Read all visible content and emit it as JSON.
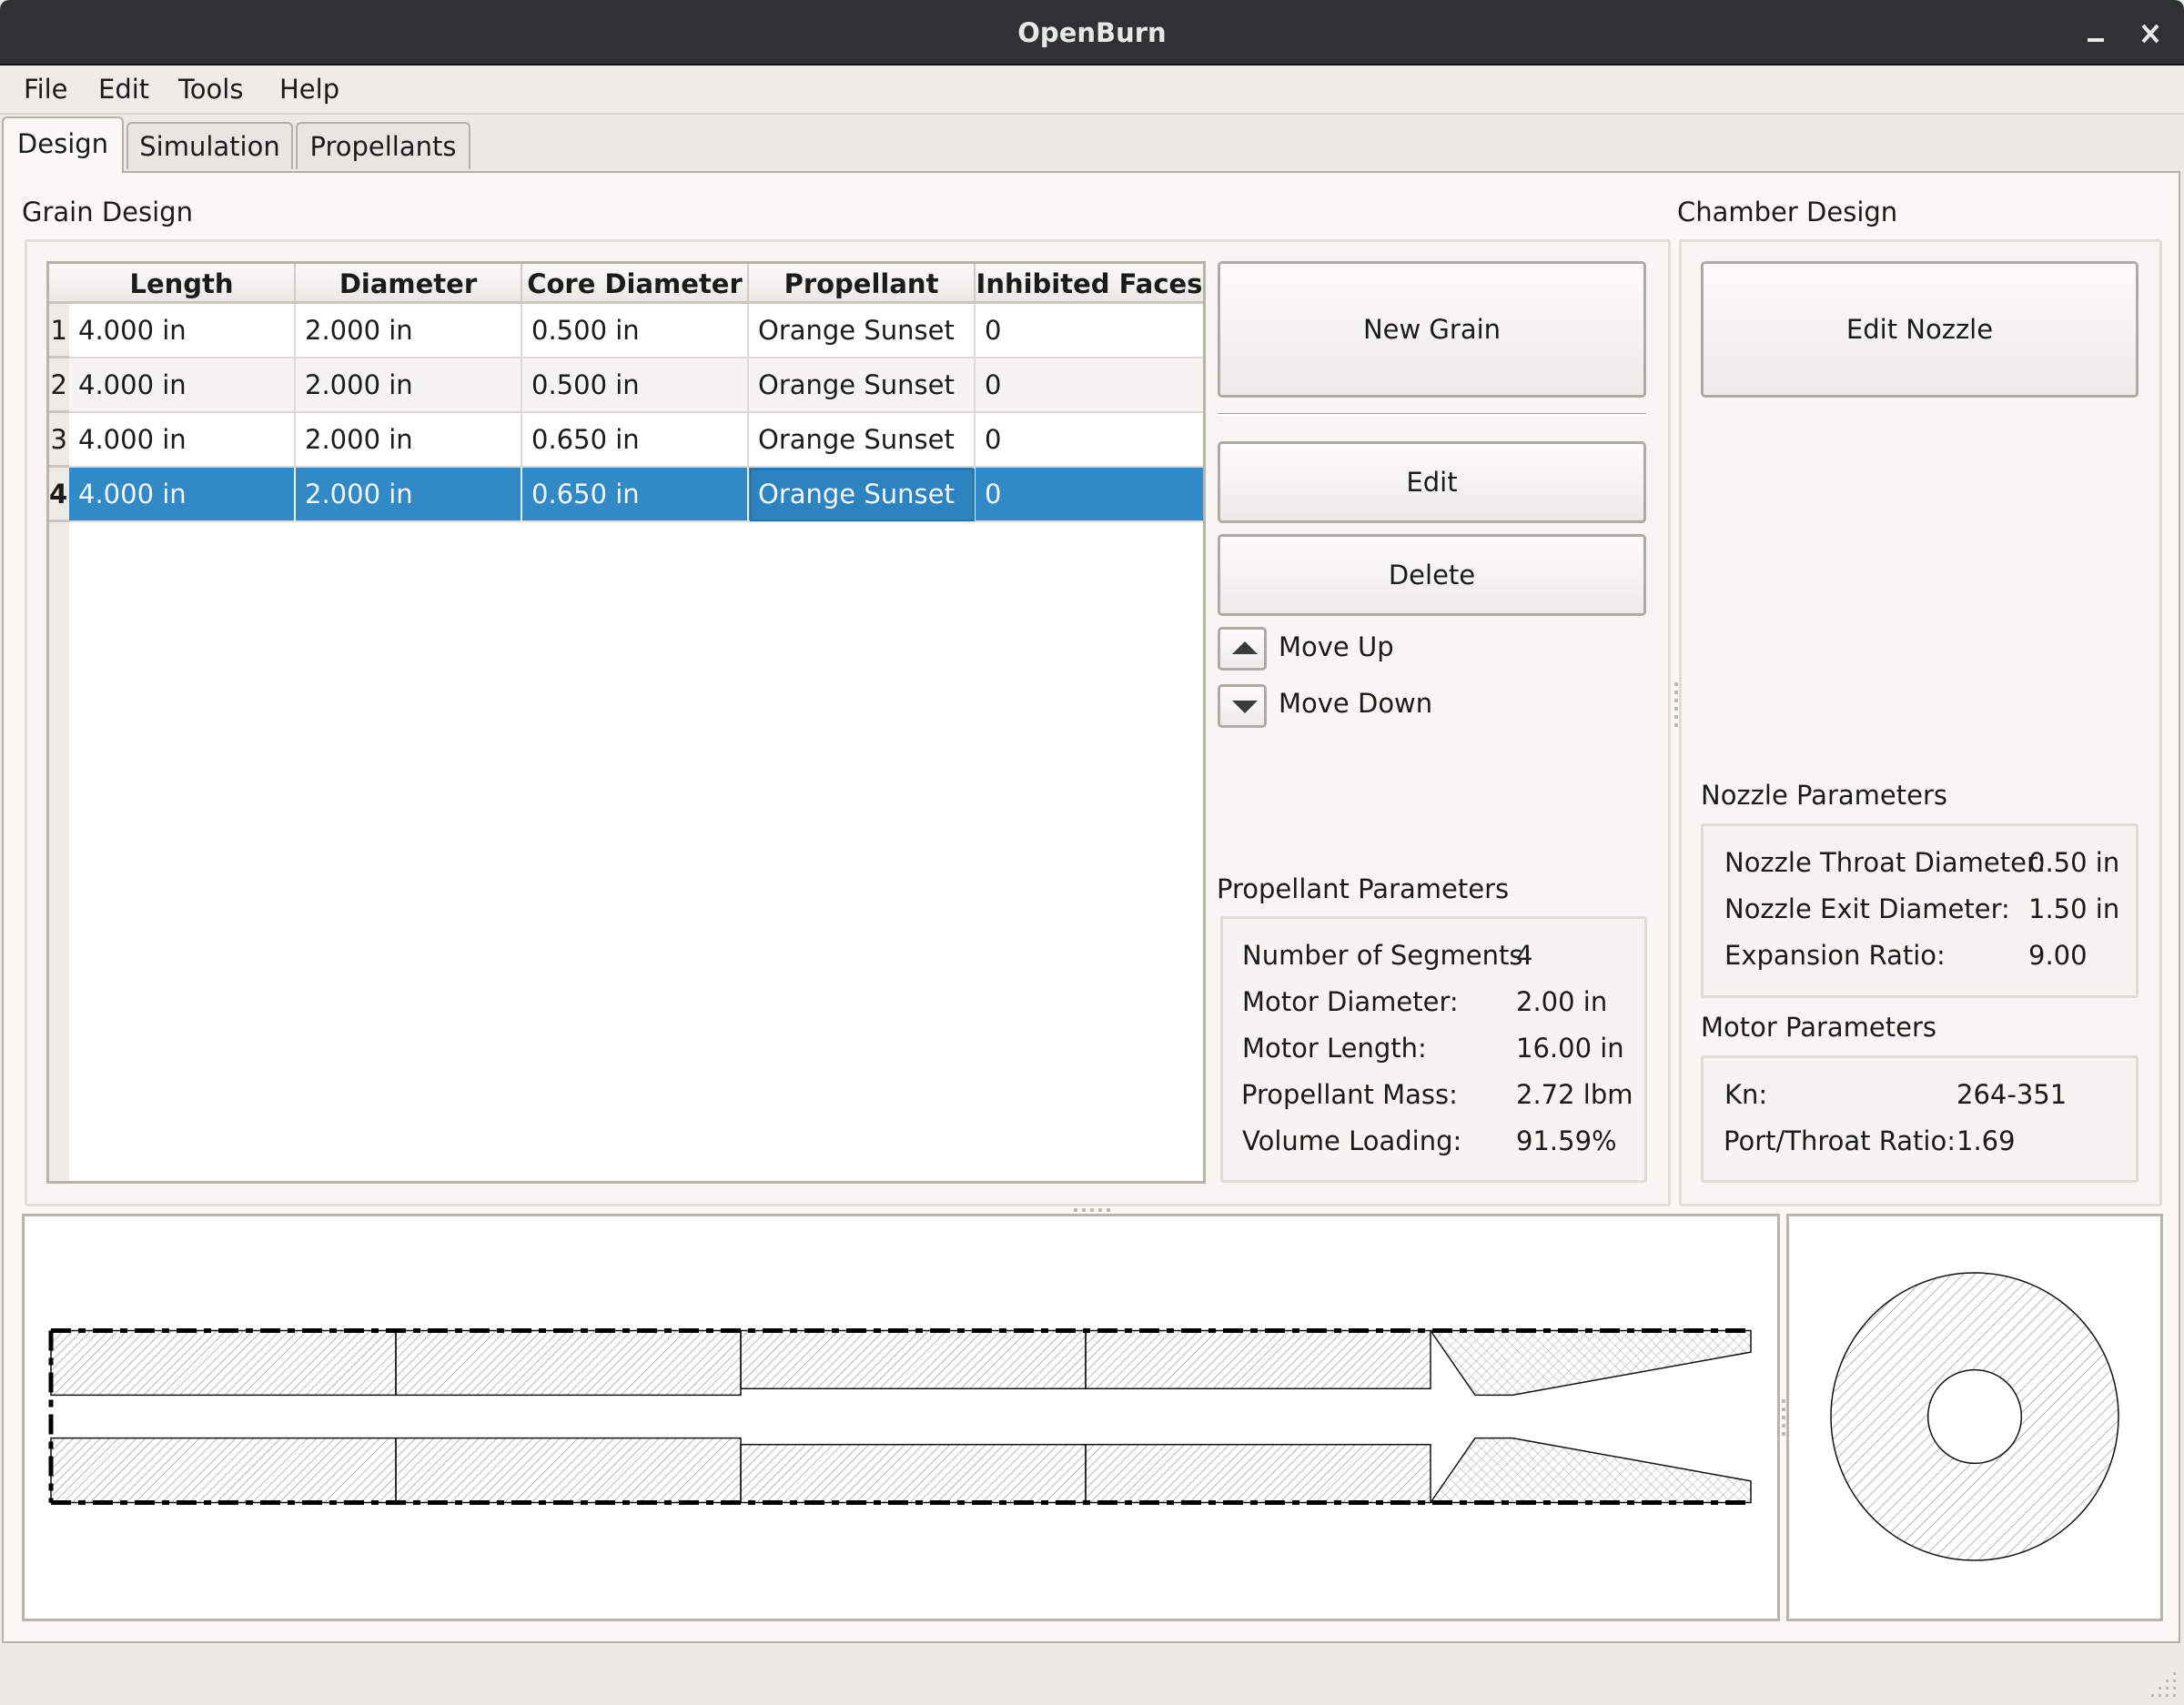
{
  "window": {
    "title": "OpenBurn",
    "minimize_icon": "minimize-icon",
    "close_icon": "close-icon",
    "minimize_glyph": "_",
    "close_glyph": "✕"
  },
  "menu": [
    "File",
    "Edit",
    "Tools",
    "Help"
  ],
  "tabs": [
    {
      "label": "Design",
      "active": true
    },
    {
      "label": "Simulation",
      "active": false
    },
    {
      "label": "Propellants",
      "active": false
    }
  ],
  "grain_design": {
    "title": "Grain Design",
    "columns": [
      "Length",
      "Diameter",
      "Core Diameter",
      "Propellant",
      "Inhibited Faces"
    ],
    "rows": [
      {
        "index": "1",
        "cells": [
          "4.000 in",
          "2.000 in",
          "0.500 in",
          "Orange Sunset",
          "0"
        ],
        "selected": false
      },
      {
        "index": "2",
        "cells": [
          "4.000 in",
          "2.000 in",
          "0.500 in",
          "Orange Sunset",
          "0"
        ],
        "selected": false
      },
      {
        "index": "3",
        "cells": [
          "4.000 in",
          "2.000 in",
          "0.650 in",
          "Orange Sunset",
          "0"
        ],
        "selected": false
      },
      {
        "index": "4",
        "cells": [
          "4.000 in",
          "2.000 in",
          "0.650 in",
          "Orange Sunset",
          "0"
        ],
        "selected": true
      }
    ],
    "buttons": {
      "new_grain": "New Grain",
      "edit": "Edit",
      "delete": "Delete",
      "move_up": "Move Up",
      "move_down": "Move Down"
    }
  },
  "propellant_parameters": {
    "title": "Propellant Parameters",
    "items": [
      {
        "label": "Number of Segments:",
        "value": "4"
      },
      {
        "label": "Motor Diameter:",
        "value": "2.00 in"
      },
      {
        "label": "Motor Length:",
        "value": "16.00 in"
      },
      {
        "label": "Propellant Mass:",
        "value": "2.72 lbm"
      },
      {
        "label": "Volume Loading:",
        "value": "91.59%"
      }
    ]
  },
  "chamber_design": {
    "title": "Chamber Design",
    "edit_nozzle": "Edit Nozzle"
  },
  "nozzle_parameters": {
    "title": "Nozzle Parameters",
    "items": [
      {
        "label": "Nozzle Throat Diameter:",
        "value": "0.50 in"
      },
      {
        "label": "Nozzle Exit Diameter:",
        "value": "1.50 in"
      },
      {
        "label": "Expansion Ratio:",
        "value": "9.00"
      }
    ]
  },
  "motor_parameters": {
    "title": "Motor Parameters",
    "items": [
      {
        "label": "Kn:",
        "value": "264-351"
      },
      {
        "label": "Port/Throat Ratio:",
        "value": "1.69"
      }
    ]
  },
  "motor_drawing": {
    "motor_diameter_in": 2.0,
    "grains": [
      {
        "length_in": 4.0,
        "diameter_in": 2.0,
        "core_in": 0.5
      },
      {
        "length_in": 4.0,
        "diameter_in": 2.0,
        "core_in": 0.5
      },
      {
        "length_in": 4.0,
        "diameter_in": 2.0,
        "core_in": 0.65
      },
      {
        "length_in": 4.0,
        "diameter_in": 2.0,
        "core_in": 0.65
      }
    ],
    "nozzle": {
      "throat_in": 0.5,
      "exit_in": 1.5
    },
    "selected_cross_section": {
      "diameter_in": 2.0,
      "core_in": 0.65
    }
  },
  "colors": {
    "selection": "#3189c6",
    "titlebar": "#2e3235",
    "window_bg": "#edeae6"
  }
}
